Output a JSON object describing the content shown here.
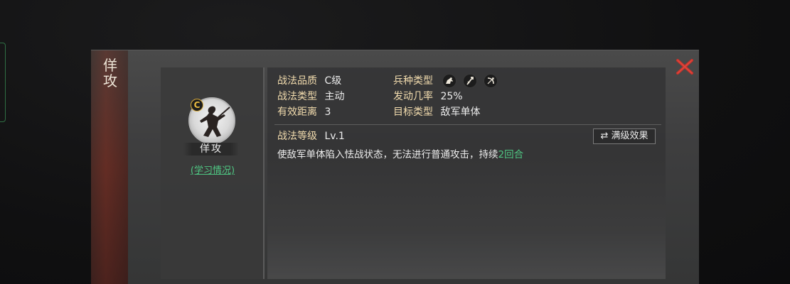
{
  "skill": {
    "name": "佯攻",
    "grade_badge": "C",
    "learn_link": "(学习情况)"
  },
  "stats": {
    "quality_label": "战法品质",
    "quality_value": "C级",
    "type_label": "战法类型",
    "type_value": "主动",
    "range_label": "有效距离",
    "range_value": "3",
    "troop_label": "兵种类型",
    "troop_icons": [
      "cavalry-icon",
      "spear-icon",
      "bow-icon"
    ],
    "rate_label": "发动几率",
    "rate_value": "25%",
    "target_label": "目标类型",
    "target_value": "敌军单体"
  },
  "level": {
    "label": "战法等级",
    "value": "Lv.1",
    "max_button": "满级效果"
  },
  "description": {
    "prefix": "使敌军单体陷入怯战状态，无法进行普通攻击，持续",
    "highlight": "2回合"
  },
  "colors": {
    "label": "#f2dcae",
    "highlight": "#4fc783",
    "close": "#c8322b"
  }
}
